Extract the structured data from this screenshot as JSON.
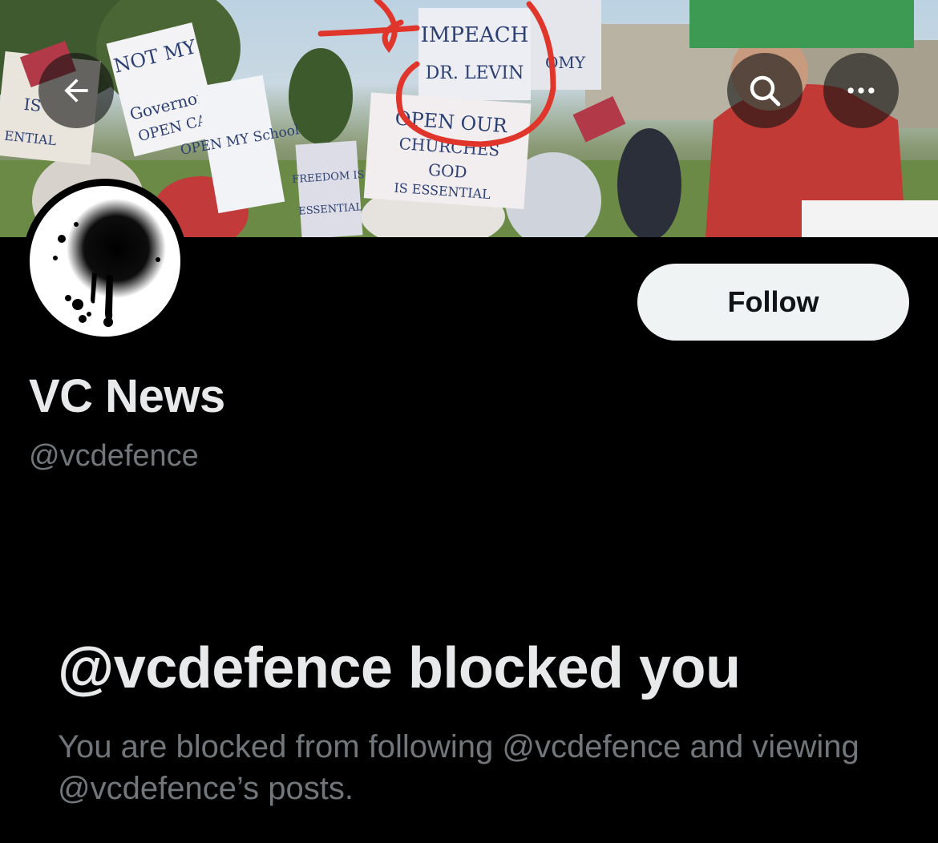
{
  "banner": {
    "description_icon": "protest-banner-photo",
    "signs": {
      "not_my": "NOT MY",
      "governor": "Governor",
      "open_ca": "OPEN CA",
      "open_my_school": "OPEN MY School",
      "impeach": "IMPEACH",
      "dr_levin": "DR. LEVIN",
      "omy": "OMY",
      "open_our": "OPEN OUR",
      "churches": "CHURCHES",
      "god": "GOD",
      "is_essential": "IS ESSENTIAL",
      "freedom_is": "FREEDOM IS",
      "essential": "ESSENTIAL",
      "ential": "ENTIAL",
      "is": "IS"
    }
  },
  "nav": {
    "back_icon": "arrow-left-icon",
    "search_icon": "search-icon",
    "more_icon": "more-horizontal-icon"
  },
  "profile": {
    "avatar_icon": "spray-paint-splatter-avatar",
    "display_name": "VC News",
    "handle": "@vcdefence",
    "follow_label": "Follow"
  },
  "blocked": {
    "title": "@vcdefence blocked you",
    "description": "You are blocked from following @vcdefence and viewing @vcdefence’s posts."
  },
  "colors": {
    "background": "#000000",
    "primary_text": "#e7e9ea",
    "secondary_text": "#71767b",
    "follow_bg": "#eff3f4",
    "follow_text": "#0f1419",
    "annotation_red": "#e0352b"
  }
}
